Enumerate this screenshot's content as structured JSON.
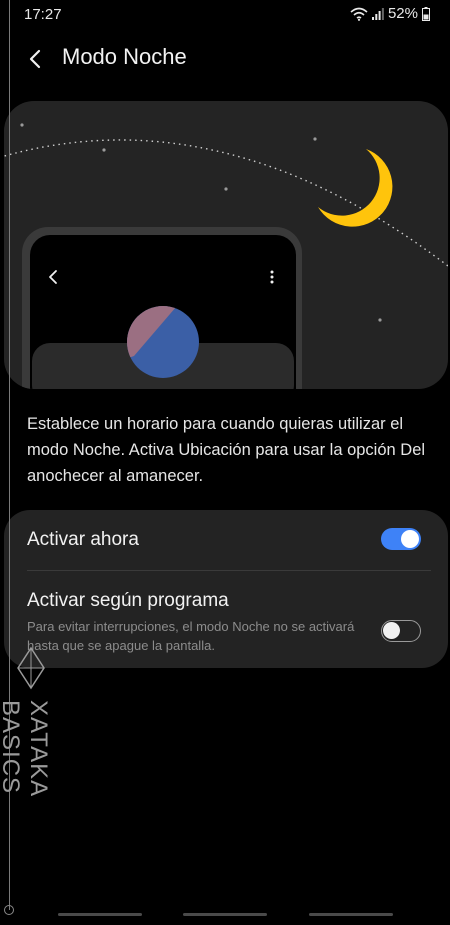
{
  "status_bar": {
    "time": "17:27",
    "battery": "52%",
    "icons": [
      "wifi-icon",
      "signal-icon",
      "battery-icon"
    ]
  },
  "header": {
    "title": "Modo Noche",
    "back_icon": "chevron-left-icon"
  },
  "illustration": {
    "icons": [
      "crescent-moon-icon",
      "chevron-left-icon",
      "more-vertical-icon"
    ],
    "colors": {
      "moon": "#ffc40c",
      "circle_top": "#9b6f82",
      "circle_bottom": "#3b5fa6",
      "card": "#242424"
    }
  },
  "description": "Establece un horario para cuando quieras utilizar el modo Noche. Activa Ubicación para usar la opción Del anochecer al amanecer.",
  "settings": {
    "activate_now": {
      "label": "Activar ahora",
      "enabled": true
    },
    "schedule": {
      "label": "Activar según programa",
      "subtitle": "Para evitar interrupciones, el modo Noche no se activará hasta que se apague la pantalla.",
      "enabled": false
    }
  },
  "watermark": {
    "text": "XATAKA BASICS",
    "icon": "xataka-logo-icon"
  },
  "colors": {
    "accent": "#3e82f7",
    "background": "#000000",
    "card": "#232323"
  }
}
